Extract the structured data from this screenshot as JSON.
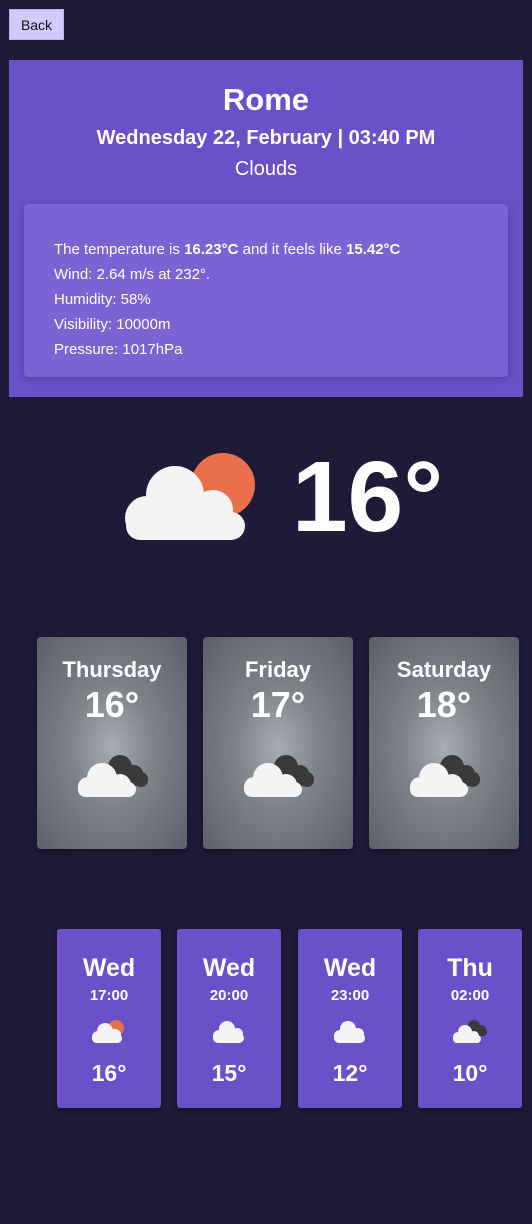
{
  "nav": {
    "back_label": "Back"
  },
  "header": {
    "city": "Rome",
    "datetime": "Wednesday 22, February | 03:40 PM",
    "condition": "Clouds"
  },
  "details": {
    "temp_prefix": "The temperature is ",
    "temp_value": "16.23°C",
    "feels_prefix": " and it feels like ",
    "feels_value": "15.42°C",
    "wind": "Wind: 2.64 m/s at 232°.",
    "humidity": "Humidity: 58%",
    "visibility": "Visibility: 10000m",
    "pressure": "Pressure: 1017hPa"
  },
  "current": {
    "temp": "16°",
    "icon": "cloud-sun-icon"
  },
  "daily": [
    {
      "day": "Thursday",
      "temp": "16°",
      "icon": "broken-clouds-icon"
    },
    {
      "day": "Friday",
      "temp": "17°",
      "icon": "broken-clouds-icon"
    },
    {
      "day": "Saturday",
      "temp": "18°",
      "icon": "broken-clouds-icon"
    }
  ],
  "hourly": [
    {
      "day": "Wed",
      "time": "17:00",
      "temp": "16°",
      "icon": "cloud-sun-icon"
    },
    {
      "day": "Wed",
      "time": "20:00",
      "temp": "15°",
      "icon": "cloud-icon"
    },
    {
      "day": "Wed",
      "time": "23:00",
      "temp": "12°",
      "icon": "cloud-icon"
    },
    {
      "day": "Thu",
      "time": "02:00",
      "temp": "10°",
      "icon": "broken-clouds-icon"
    }
  ],
  "colors": {
    "background": "#1e1a38",
    "accent_purple": "#6a51c9",
    "details_panel": "#7a63d2",
    "sun": "#e9704a",
    "cloud": "#f4f4f4",
    "dark_cloud": "#3a3a3a",
    "back_button": "#d4c9fb"
  }
}
